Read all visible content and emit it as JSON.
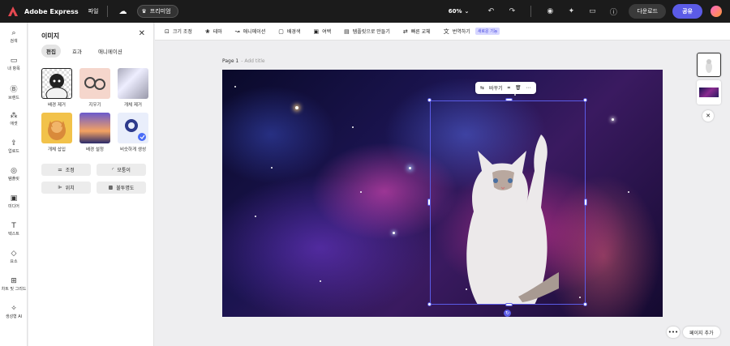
{
  "topbar": {
    "app_title": "Adobe Express",
    "file_menu": "파일",
    "premium_label": "프리미엄",
    "zoom": "60%",
    "download_label": "다운로드",
    "share_label": "공유"
  },
  "rail": {
    "items": [
      {
        "label": "검색",
        "icon": "search-icon"
      },
      {
        "label": "내 항목",
        "icon": "folder-icon"
      },
      {
        "label": "브랜드",
        "icon": "brand-icon"
      },
      {
        "label": "애셋",
        "icon": "assets-icon"
      },
      {
        "label": "업로드",
        "icon": "upload-icon"
      },
      {
        "label": "템플릿",
        "icon": "templates-icon"
      },
      {
        "label": "미디어",
        "icon": "media-icon"
      },
      {
        "label": "텍스트",
        "icon": "text-icon"
      },
      {
        "label": "요소",
        "icon": "elements-icon"
      },
      {
        "label": "차트 및 그리드",
        "icon": "grid-icon"
      },
      {
        "label": "생성형 AI",
        "icon": "gen-ai-icon"
      }
    ]
  },
  "panel": {
    "title": "이미지",
    "tabs": [
      {
        "label": "편집",
        "active": true
      },
      {
        "label": "효과",
        "active": false
      },
      {
        "label": "애니메이션",
        "active": false
      }
    ],
    "tiles": [
      {
        "label": "배경 제거"
      },
      {
        "label": "지우기"
      },
      {
        "label": "개체 제거"
      },
      {
        "label": "개체 삽입"
      },
      {
        "label": "배경 설정"
      },
      {
        "label": "비슷하게 생성"
      }
    ],
    "tools": [
      {
        "label": "조정",
        "icon": "sliders-icon"
      },
      {
        "label": "모퉁이",
        "icon": "corner-icon"
      },
      {
        "label": "위치",
        "icon": "align-icon"
      },
      {
        "label": "불투명도",
        "icon": "opacity-icon"
      }
    ]
  },
  "ctxbar": {
    "items": [
      {
        "label": "크기 조정",
        "icon": "resize-icon"
      },
      {
        "label": "테마",
        "icon": "theme-icon"
      },
      {
        "label": "애니메이션",
        "icon": "animation-icon"
      },
      {
        "label": "배경색",
        "icon": "bgcolor-icon"
      },
      {
        "label": "여백",
        "icon": "margin-icon"
      },
      {
        "label": "템플릿으로 만들기",
        "icon": "template-icon"
      },
      {
        "label": "빠른 교체",
        "icon": "swap-icon"
      },
      {
        "label": "번역하기",
        "icon": "translate-icon"
      }
    ],
    "new_badge": "새로운 기능"
  },
  "canvas": {
    "page_label": "Page 1",
    "page_sub": "- Add title",
    "sel_toolbar_replace": "바꾸기"
  },
  "bottom": {
    "more": "•••",
    "add_page": "페이지 추가"
  },
  "colors": {
    "accent": "#5b5be6",
    "topbar_bg": "#1b1b1b"
  }
}
